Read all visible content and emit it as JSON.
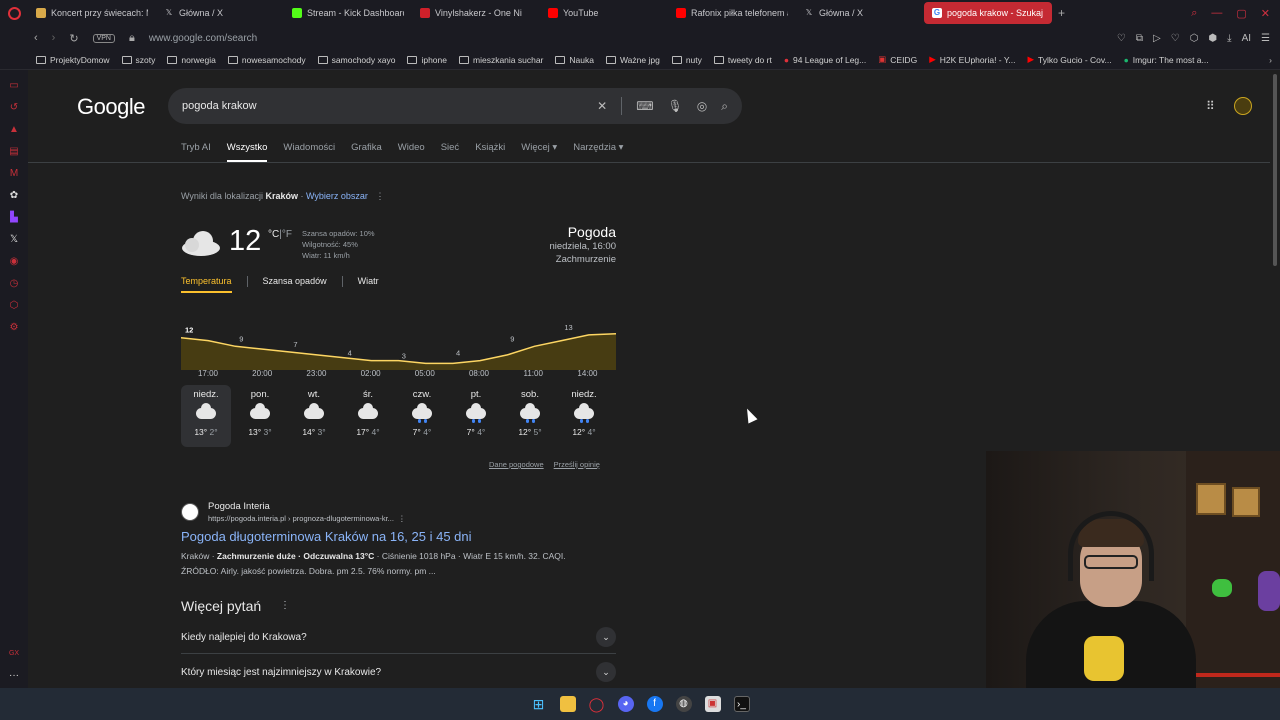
{
  "browser": {
    "tabs": [
      {
        "title": "Koncert przy świecach: M",
        "color": "#d8a94a"
      },
      {
        "title": "Główna / X",
        "color": "#ffffff"
      },
      {
        "title": "Stream - Kick Dashboard",
        "color": "#53fc18"
      },
      {
        "title": "Vinylshakerz - One Ni",
        "color": "#d0202a"
      },
      {
        "title": "YouTube",
        "color": "#ff0000"
      },
      {
        "title": "Rafonix piłka telefonem a",
        "color": "#ff0000"
      },
      {
        "title": "Główna / X",
        "color": "#ffffff"
      },
      {
        "title": "pogoda krakow - Szukaj w",
        "color": "#ffffff",
        "active": true
      }
    ],
    "new_tab": "+",
    "vpn_label": "VPN",
    "url": "www.google.com/search",
    "ai_label": "AI",
    "bookmarks": [
      {
        "label": "ProjektyDomow",
        "type": "folder"
      },
      {
        "label": "szoty",
        "type": "folder"
      },
      {
        "label": "norwegia",
        "type": "folder"
      },
      {
        "label": "nowesamochody",
        "type": "folder"
      },
      {
        "label": "samochody xayo",
        "type": "folder"
      },
      {
        "label": "iphone",
        "type": "folder"
      },
      {
        "label": "mieszkania suchar",
        "type": "folder"
      },
      {
        "label": "Nauka",
        "type": "folder"
      },
      {
        "label": "Ważne jpg",
        "type": "folder"
      },
      {
        "label": "nuty",
        "type": "folder"
      },
      {
        "label": "tweety do rt",
        "type": "folder"
      },
      {
        "label": "94 League of Leg...",
        "type": "site"
      },
      {
        "label": "CEIDG",
        "type": "site"
      },
      {
        "label": "H2K EUphoria! - Y...",
        "type": "site"
      },
      {
        "label": "Tylko Gucio - Cov...",
        "type": "site"
      },
      {
        "label": "Imgur: The most a...",
        "type": "site"
      }
    ],
    "sidebar_bottom_label": "GX"
  },
  "google": {
    "logo": "Google",
    "query": "pogoda krakow",
    "tabs": [
      "Tryb AI",
      "Wszystko",
      "Wiadomości",
      "Grafika",
      "Wideo",
      "Sieć",
      "Książki",
      "Więcej",
      "Narzędzia"
    ],
    "active_tab": "Wszystko",
    "location_prefix": "Wyniki dla lokalizacji",
    "location": "Kraków",
    "location_change": "Wybierz obszar"
  },
  "weather": {
    "temp": "12",
    "unit_c": "°C",
    "unit_sep": "|",
    "unit_f": "°F",
    "precip": "Szansa opadów: 10%",
    "humidity": "Wilgotność: 45%",
    "wind": "Wiatr: 11 km/h",
    "title": "Pogoda",
    "datetime": "niedziela, 16:00",
    "condition": "Zachmurzenie",
    "tabs": [
      "Temperatura",
      "Szansa opadów",
      "Wiatr"
    ],
    "active_tab": "Temperatura",
    "hours": [
      "17:00",
      "20:00",
      "23:00",
      "02:00",
      "05:00",
      "08:00",
      "11:00",
      "14:00"
    ],
    "days": [
      {
        "name": "niedz.",
        "high": "13°",
        "low": "2°",
        "rain": false
      },
      {
        "name": "pon.",
        "high": "13°",
        "low": "3°",
        "rain": false
      },
      {
        "name": "wt.",
        "high": "14°",
        "low": "3°",
        "rain": false
      },
      {
        "name": "śr.",
        "high": "17°",
        "low": "4°",
        "rain": false
      },
      {
        "name": "czw.",
        "high": "7°",
        "low": "4°",
        "rain": true
      },
      {
        "name": "pt.",
        "high": "7°",
        "low": "4°",
        "rain": true
      },
      {
        "name": "sob.",
        "high": "12°",
        "low": "5°",
        "rain": true
      },
      {
        "name": "niedz.",
        "high": "12°",
        "low": "4°",
        "rain": true
      }
    ],
    "link_data": "Dane pogodowe",
    "link_feedback": "Prześlij opinię"
  },
  "chart_data": {
    "type": "area",
    "x": [
      "16:00",
      "17:00",
      "20:00",
      "23:00",
      "02:00",
      "05:00",
      "08:00",
      "11:00",
      "14:00",
      "16:00"
    ],
    "labeled_points": [
      {
        "x": "16:00",
        "y": 12
      },
      {
        "x": "19:00",
        "y": 9
      },
      {
        "x": "22:00",
        "y": 7
      },
      {
        "x": "01:00",
        "y": 4
      },
      {
        "x": "04:00",
        "y": 3
      },
      {
        "x": "07:00",
        "y": 4
      },
      {
        "x": "10:00",
        "y": 9
      },
      {
        "x": "13:00",
        "y": 13
      }
    ],
    "curve": [
      12,
      11,
      9,
      8,
      7,
      6,
      5,
      4,
      4,
      3,
      3,
      4,
      6,
      9,
      11,
      13,
      13.4
    ],
    "labels": [
      "12",
      "9",
      "7",
      "4",
      "3",
      "4",
      "9",
      "13"
    ],
    "color": "#fdd663"
  },
  "result": {
    "site": "Pogoda Interia",
    "url": "https://pogoda.interia.pl › prognoza-dlugoterminowa-kr...",
    "title": "Pogoda długoterminowa Kraków na 16, 25 i 45 dni",
    "snippet_1a": "Kraków · ",
    "snippet_1b": "Zachmurzenie duże · Odczuwalna 13°C",
    "snippet_1c": " · Ciśnienie 1018 hPa · Wiatr E 15 km/h. 32. CAQI.",
    "snippet_2": "ŹRÓDŁO: Airly. jakość powietrza. Dobra. pm 2.5. 76% normy. pm ..."
  },
  "paa": {
    "title": "Więcej pytań",
    "questions": [
      "Kiedy najlepiej do Krakowa?",
      "Który miesiąc jest najzimniejszy w Krakowie?"
    ]
  }
}
